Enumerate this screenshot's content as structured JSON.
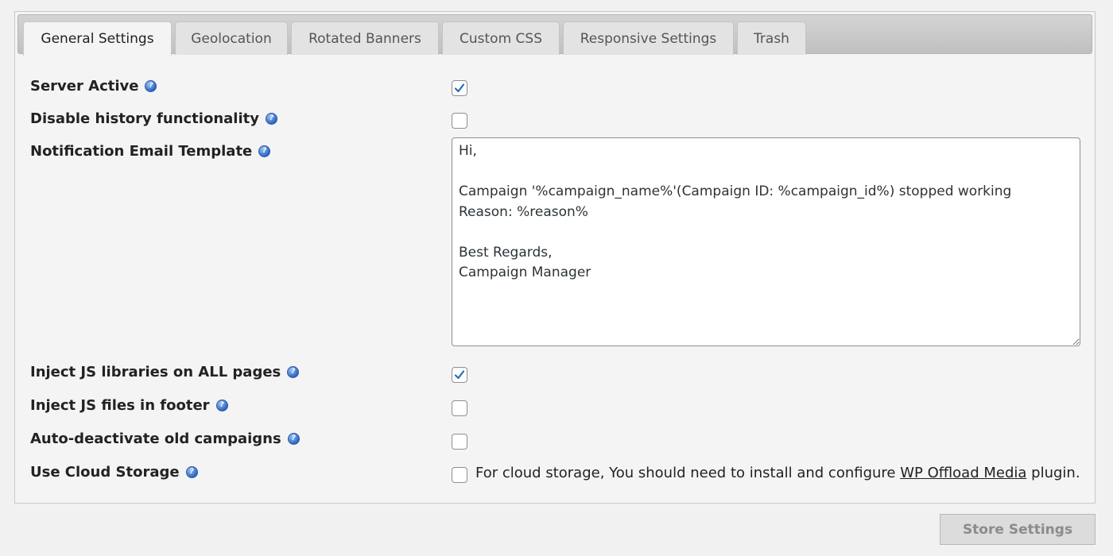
{
  "tabs": [
    {
      "label": "General Settings",
      "active": true
    },
    {
      "label": "Geolocation"
    },
    {
      "label": "Rotated Banners"
    },
    {
      "label": "Custom CSS"
    },
    {
      "label": "Responsive Settings"
    },
    {
      "label": "Trash"
    }
  ],
  "settings": {
    "server_active": {
      "label": "Server Active",
      "checked": true
    },
    "disable_history": {
      "label": "Disable history functionality",
      "checked": false
    },
    "notification_template": {
      "label": "Notification Email Template",
      "value": "Hi,\n\nCampaign '%campaign_name%'(Campaign ID: %campaign_id%) stopped working\nReason: %reason%\n\nBest Regards,\nCampaign Manager"
    },
    "inject_js_all": {
      "label": "Inject JS libraries on ALL pages",
      "checked": true
    },
    "inject_js_footer": {
      "label": "Inject JS files in footer",
      "checked": false
    },
    "auto_deactivate": {
      "label": "Auto-deactivate old campaigns",
      "checked": false
    },
    "cloud_storage": {
      "label": "Use Cloud Storage",
      "checked": false,
      "note_prefix": "For cloud storage, You should need to install and configure ",
      "note_link": "WP Offload Media",
      "note_suffix": " plugin."
    }
  },
  "help_icon_glyph": "?",
  "store_button": "Store Settings",
  "colors": {
    "checkmark": "#2271b1",
    "help_icon": "#2c66c2"
  }
}
